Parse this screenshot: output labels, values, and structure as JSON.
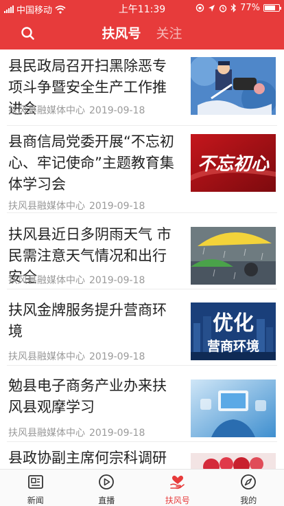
{
  "status_bar": {
    "carrier": "中国移动",
    "time": "上午11:39",
    "battery": "77%",
    "battery_level": 0.77
  },
  "nav": {
    "tabs": [
      {
        "label": "扶风号",
        "active": true
      },
      {
        "label": "关注",
        "active": false
      }
    ]
  },
  "articles": [
    {
      "title": "县民政局召开扫黑除恶专项斗争暨安全生产工作推进会",
      "source": "扶风县融媒体中心",
      "date": "2019-09-18",
      "thumb": "cartoon-police"
    },
    {
      "title": "县商信局党委开展“不忘初心、牢记使命”主题教育集体学习会",
      "source": "扶风县融媒体中心",
      "date": "2019-09-18",
      "thumb": "不忘初心"
    },
    {
      "title": "扶风县近日多阴雨天气 市民需注意天气情况和出行安全",
      "source": "扶风县融媒体中心",
      "date": "2019-09-18",
      "thumb": "rain-umbrella"
    },
    {
      "title": "扶风金牌服务提升营商环境",
      "source": "扶风县融媒体中心",
      "date": "2019-09-18",
      "thumb_text": [
        "优化",
        "营商环境"
      ]
    },
    {
      "title": "勉县电子商务产业办来扶风县观摩学习",
      "source": "扶风县融媒体中心",
      "date": "2019-09-18",
      "thumb": "ecommerce"
    },
    {
      "title": "县政协副主席何宗科调研镇",
      "source": "",
      "date": "",
      "thumb": "flowers"
    }
  ],
  "tabbar": {
    "items": [
      {
        "label": "新闻",
        "icon": "news-icon"
      },
      {
        "label": "直播",
        "icon": "live-play-icon"
      },
      {
        "label": "扶风号",
        "icon": "heart-hand-icon",
        "active": true
      },
      {
        "label": "我的",
        "icon": "compass-icon"
      }
    ]
  },
  "colors": {
    "brand": "#e73b3b",
    "text": "#222222",
    "meta": "#9a9a9a"
  }
}
